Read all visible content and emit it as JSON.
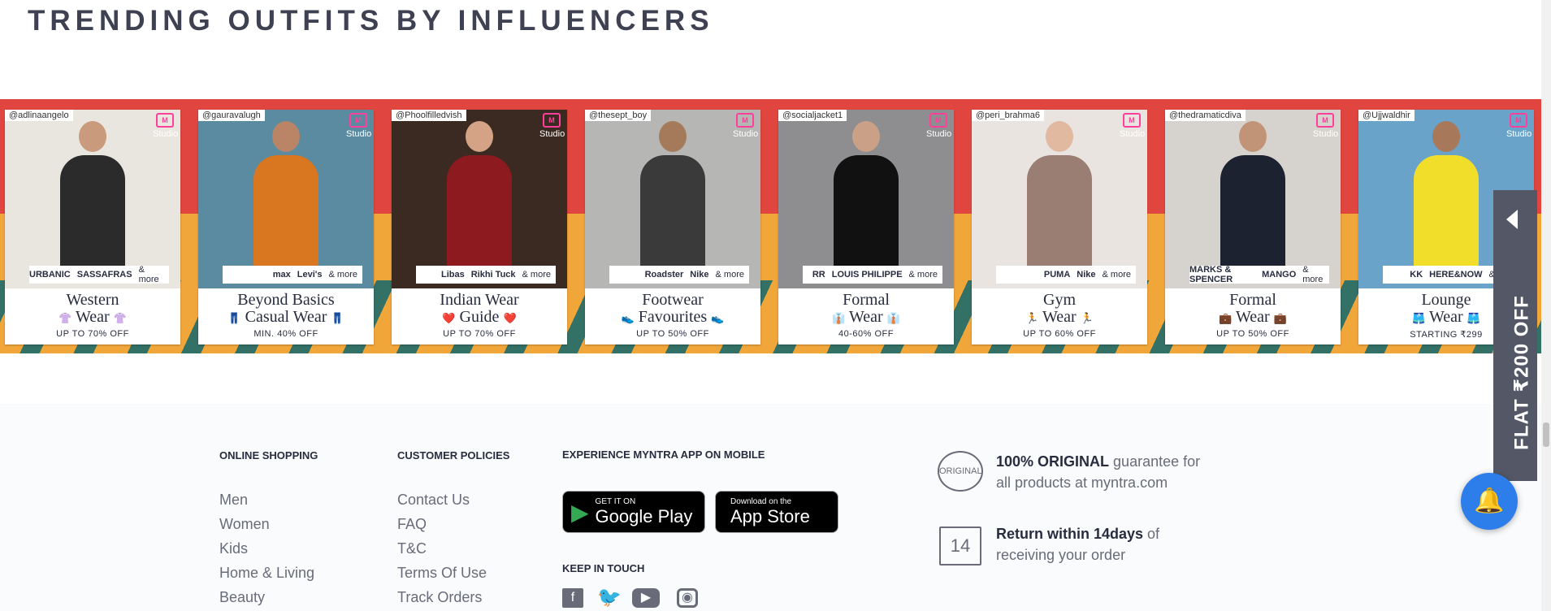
{
  "title": "TRENDING OUTFITS BY INFLUENCERS",
  "cards": [
    {
      "handle": "@adlinaangelo",
      "studio": "Studio",
      "brands": [
        "URBANIC",
        "SASSAFRAS"
      ],
      "more": "& more",
      "line1": "Western",
      "line2": "Wear",
      "emoji": "👚",
      "offer": "UP TO 70% OFF",
      "photo_bg": "#e9e5df",
      "skin": "#c99a7c",
      "outfit": "#2b2b2b"
    },
    {
      "handle": "@gauravalugh",
      "studio": "Studio",
      "brands": [
        "max",
        "Levi's"
      ],
      "more": "& more",
      "line1": "Beyond Basics",
      "line2": "Casual Wear",
      "emoji": "👖",
      "offer": "MIN. 40% OFF",
      "photo_bg": "#5b8ba0",
      "skin": "#b98566",
      "outfit": "#d8771f"
    },
    {
      "handle": "@Phoolfilledvish",
      "studio": "Studio",
      "brands": [
        "Libas",
        "Rikhi Tuck"
      ],
      "more": "& more",
      "line1": "Indian Wear",
      "line2": "Guide",
      "emoji": "❤️",
      "offer": "UP TO 70% OFF",
      "photo_bg": "#3a2a22",
      "skin": "#d4a385",
      "outfit": "#8c1a1e"
    },
    {
      "handle": "@thesept_boy",
      "studio": "Studio",
      "brands": [
        "Roadster",
        "Nike"
      ],
      "more": "& more",
      "line1": "Footwear",
      "line2": "Favourites",
      "emoji": "👟",
      "offer": "UP TO 50% OFF",
      "photo_bg": "#b6b6b4",
      "skin": "#a57a5b",
      "outfit": "#3a3a3a"
    },
    {
      "handle": "@socialjacket1",
      "studio": "Studio",
      "brands": [
        "RR",
        "LOUIS PHILIPPE"
      ],
      "more": "& more",
      "line1": "Formal",
      "line2": "Wear",
      "emoji": "👔",
      "offer": "40-60% OFF",
      "photo_bg": "#8e8e90",
      "skin": "#caa187",
      "outfit": "#111111"
    },
    {
      "handle": "@peri_brahma6",
      "studio": "Studio",
      "brands": [
        "PUMA",
        "Nike"
      ],
      "more": "& more",
      "line1": "Gym",
      "line2": "Wear",
      "emoji": "🏃",
      "offer": "UP TO 60% OFF",
      "photo_bg": "#e9e4e0",
      "skin": "#e0b9a0",
      "outfit": "#9a7d73"
    },
    {
      "handle": "@thedramaticdiva",
      "studio": "Studio",
      "brands": [
        "MARKS & SPENCER",
        "MANGO"
      ],
      "more": "& more",
      "line1": "Formal",
      "line2": "Wear",
      "emoji": "💼",
      "offer": "UP TO 50% OFF",
      "photo_bg": "#d6d3ce",
      "skin": "#c29477",
      "outfit": "#1d2230"
    },
    {
      "handle": "@Ujjwaldhir",
      "studio": "Studio",
      "brands": [
        "KK",
        "HERE&NOW"
      ],
      "more": "& more",
      "line1": "Lounge",
      "line2": "Wear",
      "emoji": "🩳",
      "offer": "STARTING ₹299",
      "photo_bg": "#6aa3c9",
      "skin": "#a8785a",
      "outfit": "#f0de2a"
    }
  ],
  "footer": {
    "online_heading": "ONLINE SHOPPING",
    "online_links": [
      "Men",
      "Women",
      "Kids",
      "Home & Living",
      "Beauty"
    ],
    "policies_heading": "CUSTOMER POLICIES",
    "policy_links": [
      "Contact Us",
      "FAQ",
      "T&C",
      "Terms Of Use",
      "Track Orders"
    ],
    "app_heading": "EXPERIENCE MYNTRA APP ON MOBILE",
    "google_small": "GET IT ON",
    "google_big": "Google Play",
    "apple_small": "Download on the",
    "apple_big": "App Store",
    "keep_heading": "KEEP IN TOUCH",
    "original_stamp": "ORIGINAL",
    "original_bold": "100% ORIGINAL",
    "original_rest": " guarantee for",
    "original_line2": "all products at myntra.com",
    "return_num": "14",
    "return_bold": "Return within 14days",
    "return_rest": " of",
    "return_line2": "receiving your order"
  },
  "side_tab": {
    "text": "FLAT ₹200 OFF"
  },
  "colors": {
    "banner_red": "#e0463f",
    "banner_orange": "#f1a63a",
    "banner_teal": "#1e6a6a",
    "bell": "#2d7eea"
  }
}
